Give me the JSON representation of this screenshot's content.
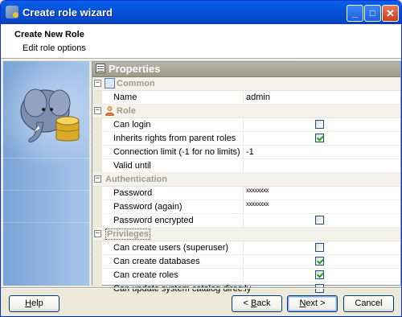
{
  "window": {
    "title": "Create role wizard"
  },
  "title_buttons": {
    "minimize": "_",
    "maximize": "□",
    "close": "✕"
  },
  "header": {
    "title": "Create New Role",
    "subtitle": "Edit role options"
  },
  "panel": {
    "title": "Properties"
  },
  "categories": {
    "common": "Common",
    "role": "Role",
    "authentication": "Authentication",
    "privileges": "Privileges"
  },
  "properties": {
    "name": {
      "label": "Name",
      "value": "admin"
    },
    "can_login": {
      "label": "Can login",
      "checked": false
    },
    "inherits": {
      "label": "Inherits rights from parent roles",
      "checked": true
    },
    "conn_limit": {
      "label": "Connection limit (-1 for no limits)",
      "value": "-1"
    },
    "valid_until": {
      "label": "Valid until",
      "value": ""
    },
    "password": {
      "label": "Password",
      "value": "xxxxxxxx"
    },
    "password_again": {
      "label": "Password (again)",
      "value": "xxxxxxxx"
    },
    "password_encrypted": {
      "label": "Password encrypted",
      "checked": false
    },
    "superuser": {
      "label": "Can create users (superuser)",
      "checked": false
    },
    "create_db": {
      "label": "Can create databases",
      "checked": true
    },
    "create_roles": {
      "label": "Can create roles",
      "checked": true
    },
    "update_catalog": {
      "label": "Can update system catalog directly",
      "checked": false
    }
  },
  "buttons": {
    "help": {
      "mnemonic": "H",
      "rest": "elp"
    },
    "back": {
      "prefix": "< ",
      "mnemonic": "B",
      "rest": "ack"
    },
    "next": {
      "mnemonic": "N",
      "rest": "ext >"
    },
    "cancel": "Cancel"
  },
  "icons": {
    "app": "elephant-database-icon",
    "sidebar": "elephant-database-illustration",
    "panel": "properties-icon"
  },
  "colors": {
    "titlebar": "#0453DA",
    "panel_header": "#9D9A8A",
    "category_text": "#A09C8A",
    "check": "#21A121"
  }
}
